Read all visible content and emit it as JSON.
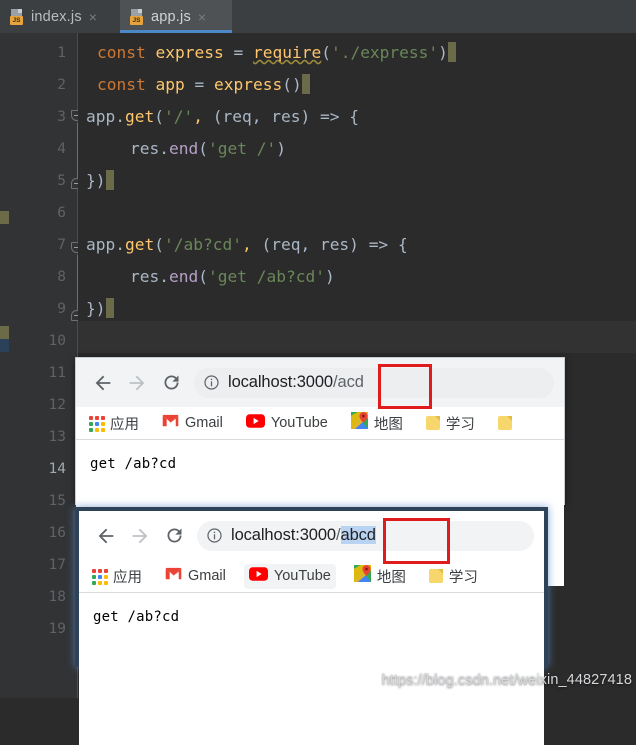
{
  "ide": {
    "tabs": [
      {
        "label": "index.js",
        "icon": "js-file-icon",
        "badge": "JS",
        "active": false
      },
      {
        "label": "app.js",
        "icon": "js-file-icon",
        "badge": "JS",
        "active": true
      }
    ],
    "close_glyph": "×",
    "current_line": 14,
    "line_numbers": [
      1,
      2,
      3,
      4,
      5,
      6,
      7,
      8,
      9,
      10,
      11,
      12,
      13,
      14,
      15,
      16,
      17,
      18,
      19
    ],
    "code": {
      "line1": {
        "kw": "const",
        "name": "express",
        "eq": "=",
        "fn": "require",
        "arg": "'./express'"
      },
      "line2": {
        "kw": "const",
        "name": "app",
        "eq": "=",
        "fn": "express",
        "call": "()"
      },
      "line3": "app.get('/', (req, res) => {",
      "line4": "res.end('get /')",
      "line5": "})",
      "line7": "app.get('/ab?cd', (req, res) => {",
      "line8": "res.end('get /ab?cd')",
      "line9": "})",
      "obj": "app",
      "dot": ".",
      "get": "get",
      "route_root": "'/'",
      "route_ab": "'/ab?cd'",
      "params": "(req, res)",
      "arrow": "=>",
      "brace_open": "{",
      "res": "res",
      "end": "end",
      "str_get_root": "'get /'",
      "str_get_ab": "'get /ab?cd'",
      "brace_close": "})",
      "comma": ","
    }
  },
  "browser1": {
    "nav": {
      "back": "back-arrow",
      "forward": "forward-arrow",
      "reload": "reload-icon"
    },
    "url": {
      "host": "localhost:3000",
      "path_sep": "/",
      "path": "acd",
      "full": "localhost:3000/acd"
    },
    "info_icon": "info-circle-icon",
    "highlight_color": "#e01b1b",
    "bookmarks": [
      {
        "label": "应用",
        "icon": "apps-grid-icon"
      },
      {
        "label": "Gmail",
        "icon": "gmail-icon"
      },
      {
        "label": "YouTube",
        "icon": "youtube-icon"
      },
      {
        "label": "地图",
        "icon": "google-maps-icon"
      },
      {
        "label": "学习",
        "icon": "folder-icon"
      },
      {
        "label": "",
        "icon": "folder-icon"
      }
    ],
    "page_text": "get /ab?cd"
  },
  "browser2": {
    "nav": {
      "back": "back-arrow",
      "forward": "forward-arrow",
      "reload": "reload-icon"
    },
    "url": {
      "host": "localhost:3000",
      "path_sep": "/",
      "path": "abcd",
      "full": "localhost:3000/abcd"
    },
    "info_icon": "info-circle-icon",
    "highlight_color": "#e01b1b",
    "bookmarks": [
      {
        "label": "应用",
        "icon": "apps-grid-icon"
      },
      {
        "label": "Gmail",
        "icon": "gmail-icon"
      },
      {
        "label": "YouTube",
        "icon": "youtube-icon"
      },
      {
        "label": "地图",
        "icon": "google-maps-icon"
      },
      {
        "label": "学习",
        "icon": "folder-icon"
      }
    ],
    "page_text": "get /ab?cd"
  },
  "watermark": "https://blog.csdn.net/weixin_44827418"
}
